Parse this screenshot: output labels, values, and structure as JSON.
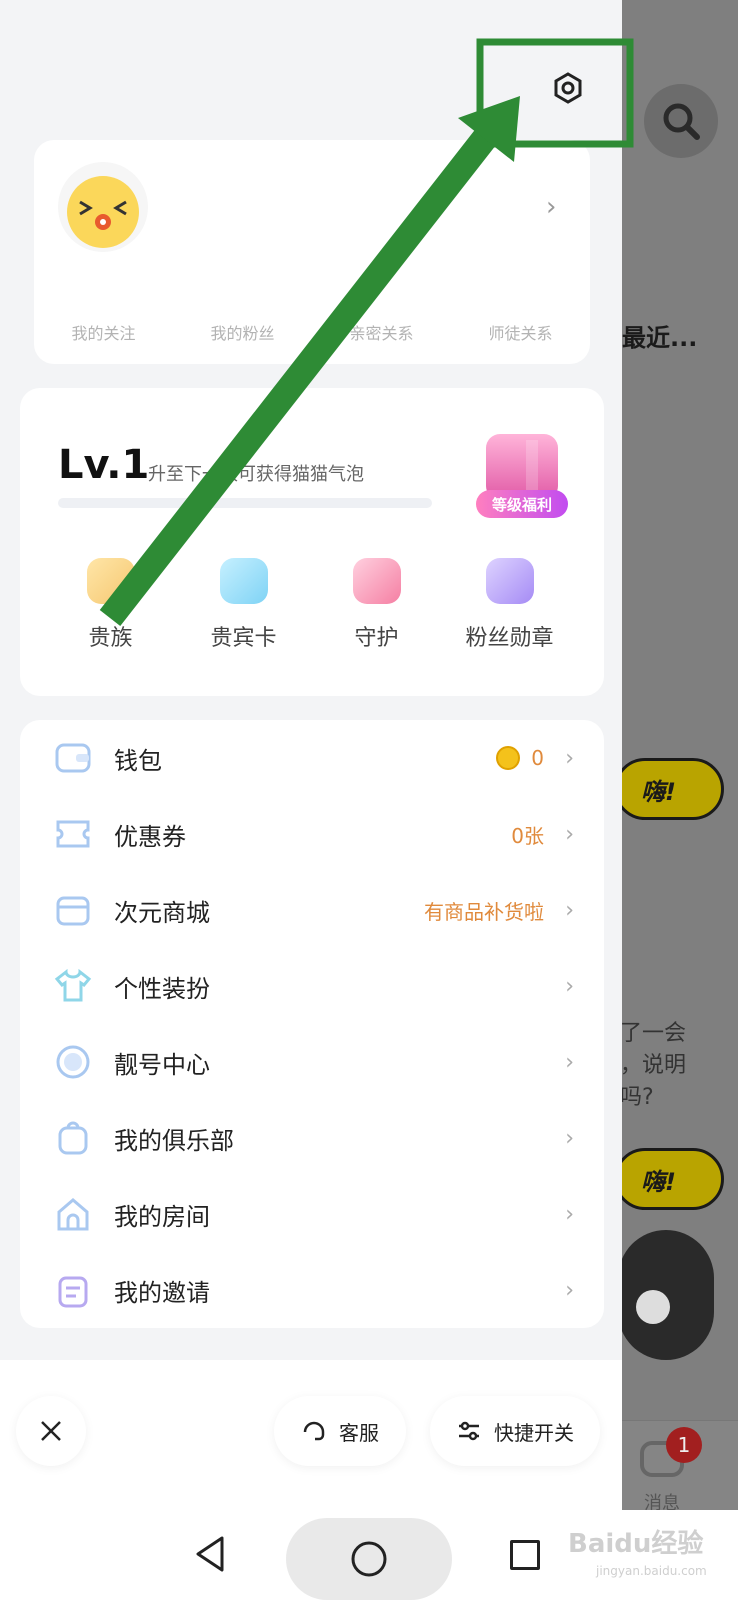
{
  "background_app": {
    "recent_label": "最近...",
    "hi_label": "嗨!",
    "snippet_lines": [
      "了一会",
      "，说明",
      "吗?"
    ],
    "nav_messages_label": "消息",
    "nav_messages_badge": "1"
  },
  "profile": {
    "stats": [
      "我的关注",
      "我的粉丝",
      "亲密关系",
      "师徒关系"
    ]
  },
  "level": {
    "title": "Lv.1",
    "description": "升至下一级可获得猫猫气泡",
    "gift_label": "等级福利",
    "perks": [
      {
        "label": "贵族",
        "icon": "noble-icon",
        "color": "#f5c66f"
      },
      {
        "label": "贵宾卡",
        "icon": "vip-card-icon",
        "color": "#7fd3f5"
      },
      {
        "label": "守护",
        "icon": "guard-icon",
        "color": "#f57fa3"
      },
      {
        "label": "粉丝勋章",
        "icon": "fan-medal-icon",
        "color": "#a58bf5"
      }
    ]
  },
  "menu": [
    {
      "label": "钱包",
      "value": "0",
      "icon": "wallet-icon"
    },
    {
      "label": "优惠券",
      "value": "0张",
      "icon": "coupon-icon"
    },
    {
      "label": "次元商城",
      "value": "有商品补货啦",
      "icon": "store-icon"
    },
    {
      "label": "个性装扮",
      "value": "",
      "icon": "outfit-icon"
    },
    {
      "label": "靓号中心",
      "value": "",
      "icon": "pretty-id-icon"
    },
    {
      "label": "我的俱乐部",
      "value": "",
      "icon": "club-icon"
    },
    {
      "label": "我的房间",
      "value": "",
      "icon": "room-icon"
    },
    {
      "label": "我的邀请",
      "value": "",
      "icon": "invite-icon"
    }
  ],
  "footer": {
    "service_label": "客服",
    "quick_switch_label": "快捷开关"
  },
  "watermark": {
    "main": "Baidu经验",
    "sub": "jingyan.baidu.com"
  },
  "colors": {
    "annotation_green": "#2e8b35",
    "accent_orange": "#e08a3c"
  }
}
